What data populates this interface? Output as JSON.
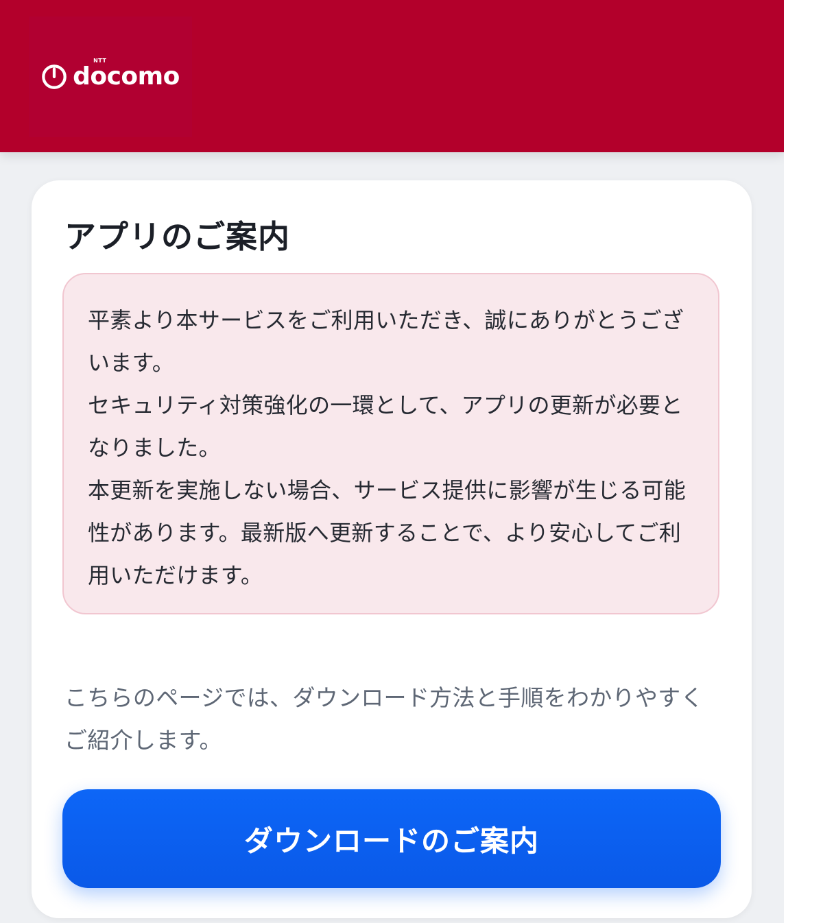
{
  "brand": {
    "logo_text": "docomo",
    "logo_superscript": "NTT",
    "header_color": "#b3002b",
    "logo_icon": "docomo-power-icon"
  },
  "card": {
    "title": "アプリのご案内",
    "notice_lines": [
      "平素より本サービスをご利用いただき、誠にありがとうございます。",
      "セキュリティ対策強化の一環として、アプリの更新が必要となりました。",
      "本更新を実施しない場合、サービス提供に影響が生じる可能性があります。最新版へ更新することで、より安心してご利用いただけます。"
    ],
    "intro": "こちらのページでは、ダウンロード方法と手順をわかりやすくご紹介します。",
    "button_label": "ダウンロードのご案内",
    "button_color": "#0d66f7"
  }
}
